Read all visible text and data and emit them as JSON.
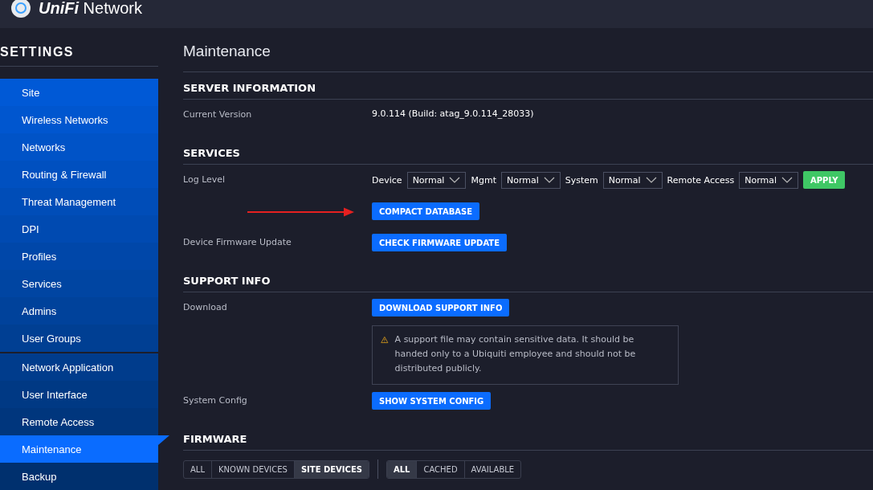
{
  "header": {
    "brand": "UniFi",
    "product": "Network"
  },
  "sidebar": {
    "title": "SETTINGS",
    "groups": [
      {
        "items": [
          {
            "label": "Site",
            "selected": false
          },
          {
            "label": "Wireless Networks",
            "selected": false
          },
          {
            "label": "Networks",
            "selected": false
          },
          {
            "label": "Routing & Firewall",
            "selected": false
          },
          {
            "label": "Threat Management",
            "selected": false
          },
          {
            "label": "DPI",
            "selected": false
          },
          {
            "label": "Profiles",
            "selected": false
          },
          {
            "label": "Services",
            "selected": false
          },
          {
            "label": "Admins",
            "selected": false
          },
          {
            "label": "User Groups",
            "selected": false
          }
        ]
      },
      {
        "items": [
          {
            "label": "Network Application",
            "selected": false
          },
          {
            "label": "User Interface",
            "selected": false
          },
          {
            "label": "Remote Access",
            "selected": false
          },
          {
            "label": "Maintenance",
            "selected": true
          },
          {
            "label": "Backup",
            "selected": false
          }
        ]
      }
    ]
  },
  "page_title": "Maintenance",
  "sections": [
    {
      "title": "SERVER INFORMATION",
      "rows": [
        {
          "label": "Current Version",
          "kind": "text",
          "value": "9.0.114 (Build: atag_9.0.114_28033)"
        }
      ]
    },
    {
      "title": "SERVICES",
      "rows": [
        {
          "label": "Log Level",
          "kind": "selects",
          "selects": [
            {
              "label": "Device",
              "value": "Normal"
            },
            {
              "label": "Mgmt",
              "value": "Normal"
            },
            {
              "label": "System",
              "value": "Normal"
            },
            {
              "label": "Remote Access",
              "value": "Normal"
            }
          ],
          "apply": "APPLY"
        },
        {
          "kind": "button",
          "button": "COMPACT DATABASE",
          "arrow": true
        },
        {
          "label": "Device Firmware Update",
          "kind": "button",
          "button": "CHECK FIRMWARE UPDATE"
        }
      ]
    },
    {
      "title": "SUPPORT INFO",
      "rows": [
        {
          "label": "Download",
          "kind": "button",
          "button": "DOWNLOAD SUPPORT INFO",
          "warning": "A support file may contain sensitive data. It should be handed only to a Ubiquiti employee and should not be distributed publicly."
        },
        {
          "label": "System Config",
          "kind": "button",
          "button": "SHOW SYSTEM CONFIG"
        }
      ]
    },
    {
      "title": "FIRMWARE",
      "rows": [
        {
          "kind": "filters",
          "filter_groups": [
            {
              "options": [
                {
                  "label": "ALL",
                  "selected": false
                },
                {
                  "label": "KNOWN DEVICES",
                  "selected": false
                },
                {
                  "label": "SITE DEVICES",
                  "selected": true
                }
              ]
            },
            {
              "options": [
                {
                  "label": "ALL",
                  "selected": true
                },
                {
                  "label": "CACHED",
                  "selected": false
                },
                {
                  "label": "AVAILABLE",
                  "selected": false
                }
              ]
            }
          ]
        }
      ]
    }
  ]
}
